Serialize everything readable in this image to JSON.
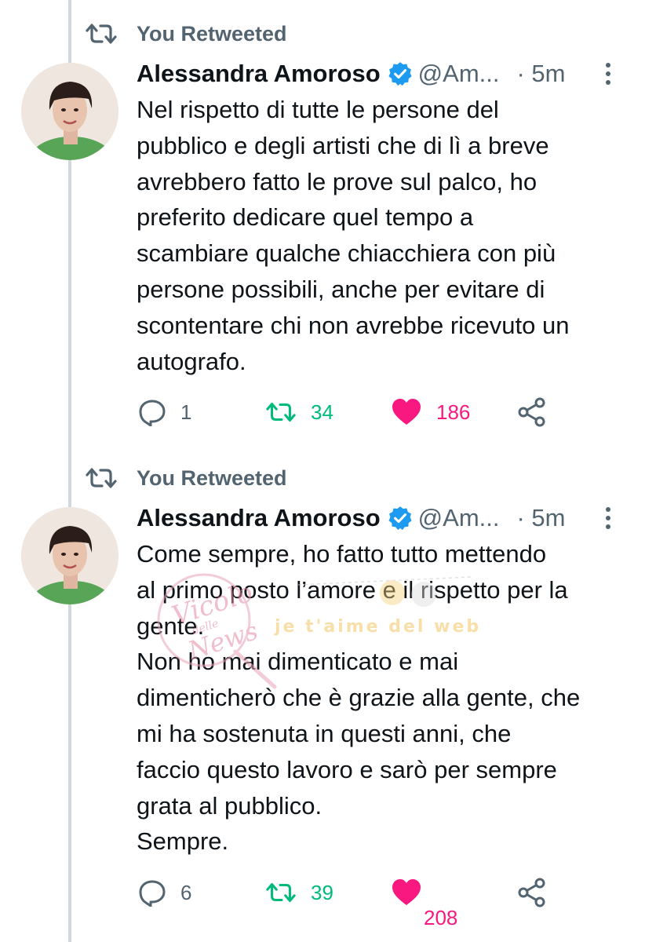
{
  "colors": {
    "text_primary": "#0f1419",
    "text_secondary": "#536471",
    "verified_blue": "#1d9bf0",
    "retweet_green": "#00ba7c",
    "like_pink": "#f91880",
    "thread_line": "#cfd9de"
  },
  "tweets": [
    {
      "social_context": "You Retweeted",
      "author_name": "Alessandra Amoroso",
      "handle": "@Am...",
      "time": "· 5m",
      "text_lines": [
        "Nel rispetto di tutte le persone del",
        "pubblico e degli artisti che di lì a breve",
        "avrebbero fatto le prove sul palco, ho",
        "preferito dedicare quel tempo a",
        "scambiare qualche chiacchiera con più",
        "persone possibili, anche per evitare di",
        "scontentare chi non avrebbe ricevuto un",
        "autografo."
      ],
      "replies": "1",
      "retweets": "34",
      "likes": "186",
      "icons": [
        "retweet-icon",
        "verified-badge-icon",
        "more-vertical-icon",
        "reply-icon",
        "retweet-icon",
        "heart-filled-icon",
        "share-icon"
      ]
    },
    {
      "social_context": "You Retweeted",
      "author_name": "Alessandra Amoroso",
      "handle": "@Am...",
      "time": "· 5m",
      "text_lines": [
        "Come sempre, ho fatto tutto mettendo",
        "al primo posto l’amore e il rispetto per la",
        "gente.",
        "Non ho mai dimenticato e mai",
        "dimenticherò che è grazie alla gente, che",
        "mi ha sostenuta in questi anni, che",
        "faccio questo lavoro e sarò per sempre",
        "grata al pubblico.",
        "Sempre."
      ],
      "replies": "6",
      "retweets": "39",
      "likes": "208",
      "icons": [
        "retweet-icon",
        "verified-badge-icon",
        "more-vertical-icon",
        "reply-icon",
        "retweet-icon",
        "heart-filled-icon",
        "share-icon"
      ]
    }
  ],
  "watermark": {
    "script_text": "Vicolo delle News",
    "tagline": "je t'aime del web"
  }
}
